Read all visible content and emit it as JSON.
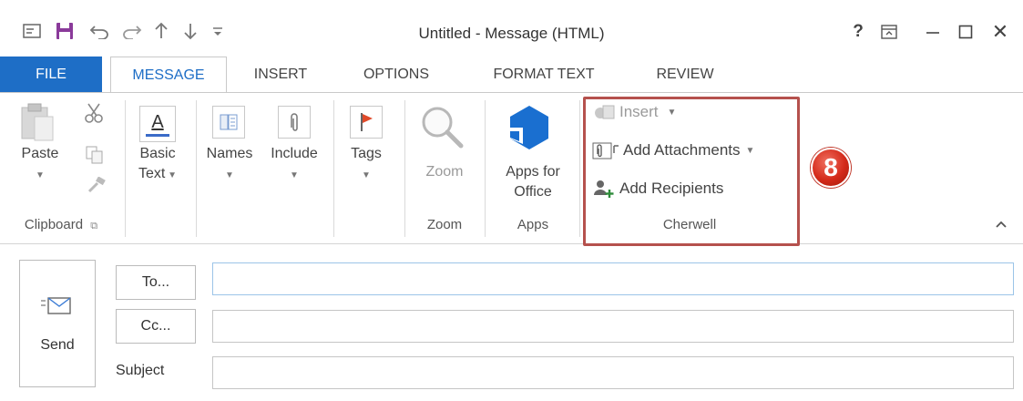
{
  "window": {
    "title": "Untitled - Message (HTML)",
    "help": "?",
    "close": "✕"
  },
  "tabs": {
    "file": "FILE",
    "message": "MESSAGE",
    "insert": "INSERT",
    "options": "OPTIONS",
    "format_text": "FORMAT TEXT",
    "review": "REVIEW"
  },
  "ribbon": {
    "paste": "Paste",
    "basic_text_1": "Basic",
    "basic_text_2": "Text",
    "names": "Names",
    "include": "Include",
    "tags": "Tags",
    "zoom": "Zoom",
    "apps_1": "Apps for",
    "apps_2": "Office",
    "groups": {
      "clipboard": "Clipboard",
      "zoom": "Zoom",
      "apps": "Apps",
      "cherwell": "Cherwell"
    },
    "cherwell": {
      "insert": "Insert",
      "add_attachments": "Add Attachments",
      "add_recipients": "Add Recipients"
    }
  },
  "callout": {
    "number": "8"
  },
  "compose": {
    "send": "Send",
    "to": "To...",
    "cc": "Cc...",
    "subject": "Subject",
    "to_value": "",
    "cc_value": "",
    "subject_value": ""
  },
  "colors": {
    "accent": "#1e6ec6",
    "highlight_border": "#b5514d",
    "badge": "#d42a1a"
  }
}
